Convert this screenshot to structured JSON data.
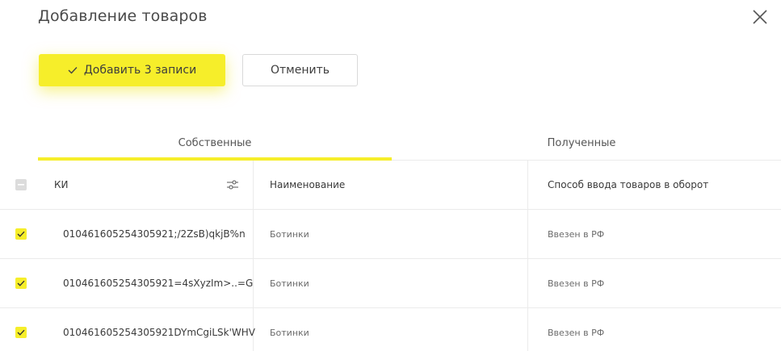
{
  "dialog": {
    "title": "Добавление товаров",
    "close_icon": "close-icon"
  },
  "actions": {
    "add_label": "Добавить 3 записи",
    "cancel_label": "Отменить"
  },
  "tabs": [
    {
      "label": "Собственные",
      "active": true
    },
    {
      "label": "Полученные",
      "active": false
    }
  ],
  "table": {
    "columns": [
      "КИ",
      "Наименование",
      "Способ ввода товаров в оборот"
    ],
    "select_all_state": "indeterminate",
    "rows": [
      {
        "checked": true,
        "ki": "010461605254305921;/2ZsB)qkjB%n",
        "name": "Ботинки",
        "method": "Ввезен в РФ"
      },
      {
        "checked": true,
        "ki": "010461605254305921=4sXyzIm>..=G",
        "name": "Ботинки",
        "method": "Ввезен в РФ"
      },
      {
        "checked": true,
        "ki": "010461605254305921DYmCgiLSk'WHV",
        "name": "Ботинки",
        "method": "Ввезен в РФ"
      }
    ]
  },
  "colors": {
    "accent": "#f6ee2a",
    "border": "#ebebeb"
  }
}
